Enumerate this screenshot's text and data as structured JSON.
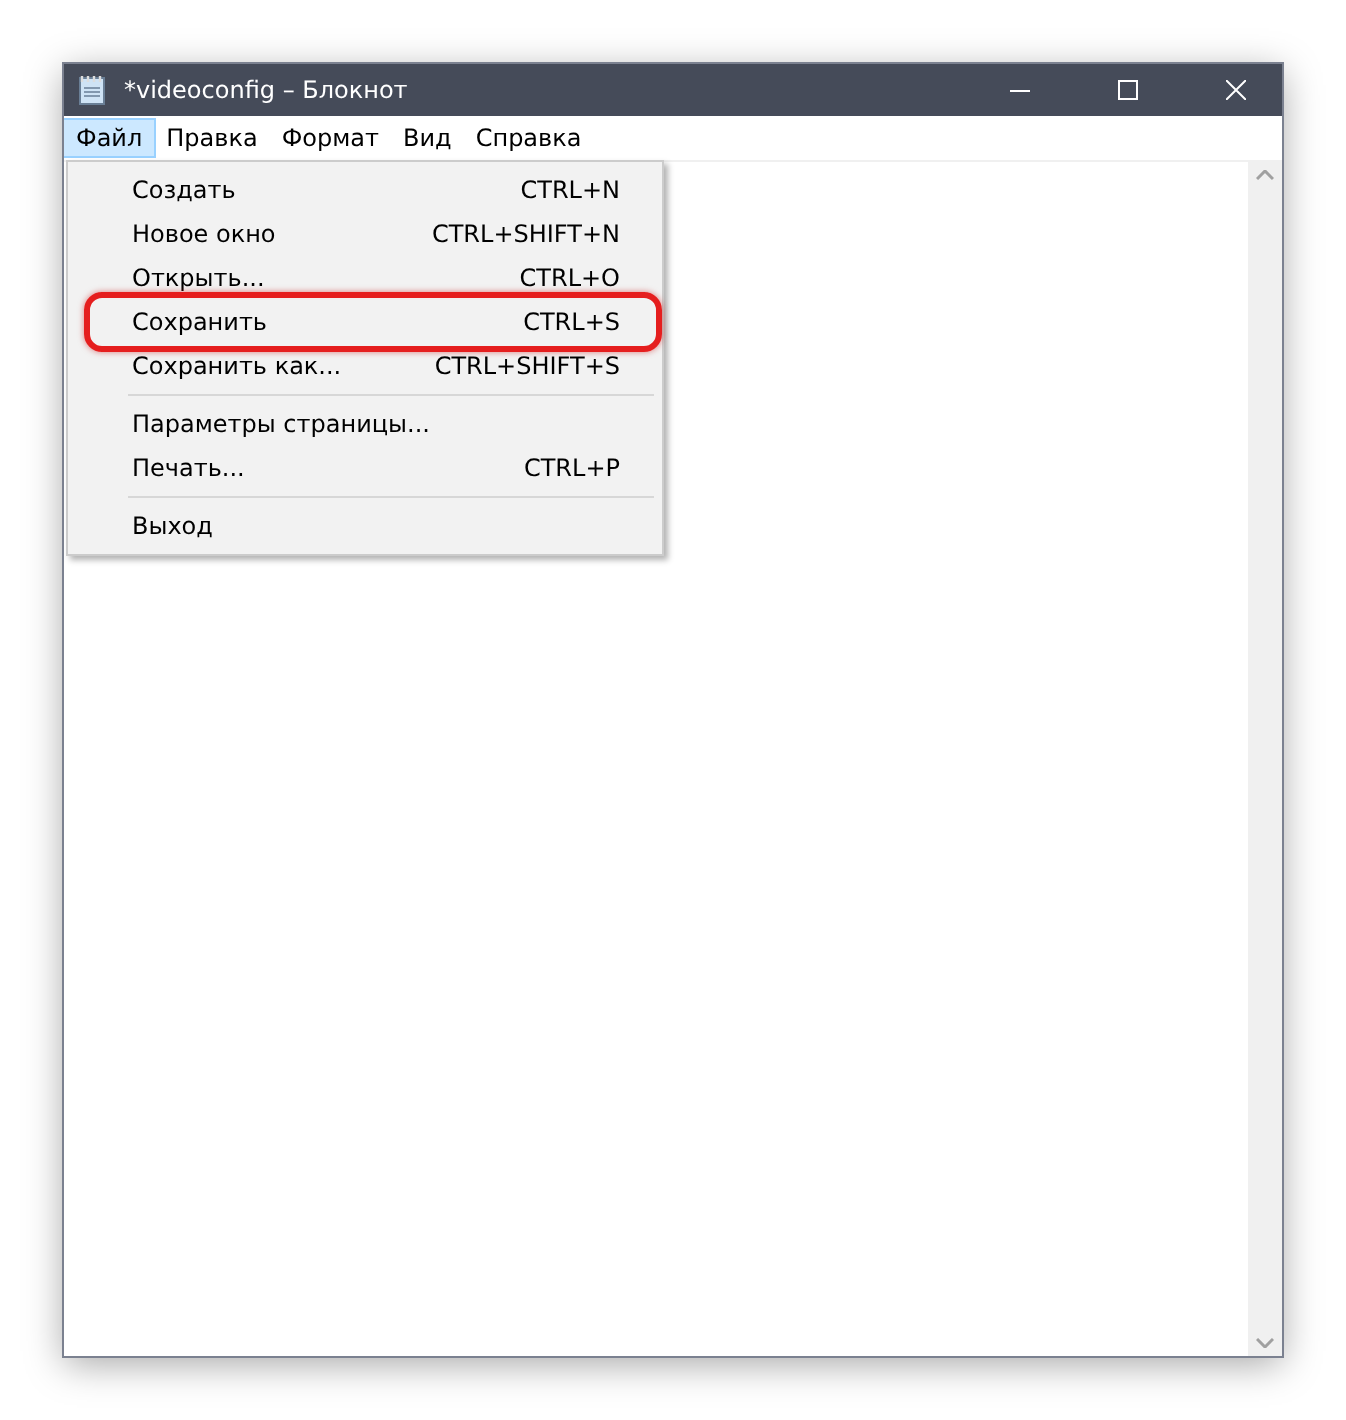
{
  "window": {
    "title": "*videoconfig – Блокнот"
  },
  "menu_bar": [
    {
      "label": "Файл",
      "selected": true
    },
    {
      "label": "Правка",
      "selected": false
    },
    {
      "label": "Формат",
      "selected": false
    },
    {
      "label": "Вид",
      "selected": false
    },
    {
      "label": "Справка",
      "selected": false
    }
  ],
  "file_menu": [
    {
      "kind": "item",
      "label": "Создать",
      "shortcut": "CTRL+N",
      "highlighted": false
    },
    {
      "kind": "item",
      "label": "Новое окно",
      "shortcut": "CTRL+SHIFT+N",
      "highlighted": false
    },
    {
      "kind": "item",
      "label": "Открыть...",
      "shortcut": "CTRL+O",
      "highlighted": false
    },
    {
      "kind": "item",
      "label": "Сохранить",
      "shortcut": "CTRL+S",
      "highlighted": true
    },
    {
      "kind": "item",
      "label": "Сохранить как...",
      "shortcut": "CTRL+SHIFT+S",
      "highlighted": false
    },
    {
      "kind": "separator"
    },
    {
      "kind": "item",
      "label": "Параметры страницы...",
      "highlighted": false
    },
    {
      "kind": "item",
      "label": "Печать...",
      "shortcut": "CTRL+P",
      "highlighted": false
    },
    {
      "kind": "separator"
    },
    {
      "kind": "item",
      "label": "Выход",
      "highlighted": false
    }
  ]
}
